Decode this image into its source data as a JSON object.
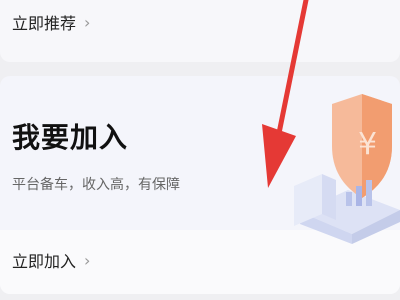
{
  "top_card": {
    "link_label": "立即推荐"
  },
  "main_card": {
    "title": "我要加入",
    "subtitle": "平台备车，收入高，有保障",
    "link_label": "立即加入"
  },
  "icons": {
    "chevron": "›"
  },
  "colors": {
    "annotation_arrow": "#e53935",
    "shield": "#f4a67a"
  }
}
